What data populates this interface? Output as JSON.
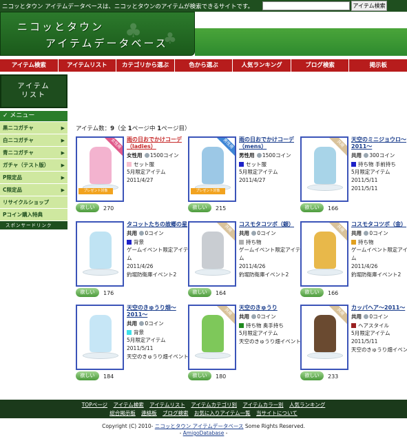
{
  "topbar": {
    "message": "ニコッとタウン アイテムデータベースは、ニコッとタウンのアイテムが検索できるサイトです。",
    "search_placeholder": "",
    "search_button": "アイテム検索"
  },
  "logo": {
    "line1": "ニコッとタウン",
    "line2": "アイテムデータベース"
  },
  "nav": [
    "アイテム検索",
    "アイテムリスト",
    "カテゴリから選ぶ",
    "色から選ぶ",
    "人気ランキング",
    "ブログ検索",
    "掲示板"
  ],
  "sidebar": {
    "title_line1": "アイテム",
    "title_line2": "リスト",
    "menu_head": "メニュー",
    "items": [
      "黒ニコガチャ",
      "白ニコガチャ",
      "青ニコガチャ",
      "ガチャ（テスト版）",
      "P限定品",
      "C限定品",
      "リサイクルショップ",
      "Pコイン購入特典"
    ],
    "sponsor": "スポンサードリンク"
  },
  "count": {
    "label": "アイテム数：",
    "num": "9",
    "mid": "（全 ",
    "pages": "1",
    "mid2": "ページ中 ",
    "page": "1",
    "tail": "ページ目）"
  },
  "want_label": "欲しい",
  "coin_unit": "コイン",
  "items": [
    {
      "name": "雨の日おでかけコーデ（ladies）",
      "name_color": "red",
      "gender": "女性用",
      "coin": "1500",
      "category": "セット服",
      "cat_color": "#f6c0cf",
      "note1": "5月限定アイテム",
      "note2": "2011/4/27",
      "count": "270",
      "badge": "女性用",
      "badge_color": "#e05a8a",
      "fig_color": "#f3b3cf",
      "present": "プレゼント対象"
    },
    {
      "name": "雨の日おでかけコーデ（mens）",
      "name_color": "blue",
      "gender": "男性用",
      "coin": "1500",
      "category": "セット服",
      "cat_color": "#1e22c8",
      "note1": "5月限定アイテム",
      "note2": "2011/4/27",
      "count": "215",
      "badge": "男性用",
      "badge_color": "#3f86d6",
      "fig_color": "#9cc8e6",
      "present": "プレゼント対象"
    },
    {
      "name": "天空のミニジョウロ～2011～",
      "name_color": "blue",
      "gender": "共用",
      "coin": "300",
      "category": "持ち物 手前持ち",
      "cat_color": "#1e22c8",
      "note1": "5月限定アイテム",
      "note2": "2011/5/11",
      "count": "166",
      "badge": "共用",
      "badge_color": "#d9c29a",
      "fig_color": "#a8d4e8",
      "present": ""
    },
    {
      "name": "タコットたちの故郷の星",
      "name_color": "blue",
      "gender": "共用",
      "coin": "0",
      "category": "背景",
      "cat_color": "#1e22c8",
      "note1": "ゲームイベント限定アイテム",
      "note2": "2011/4/26",
      "count": "176",
      "badge": "",
      "badge_color": "",
      "fig_color": "#bfe3f3",
      "present": ""
    },
    {
      "name": "コスモタコツボ（銀）",
      "name_color": "blue",
      "gender": "共用",
      "coin": "0",
      "category": "持ち物",
      "cat_color": "#b0b0b0",
      "note1": "ゲームイベント限定アイテム",
      "note2": "2011/4/26",
      "count": "164",
      "badge": "共用",
      "badge_color": "#d9c29a",
      "fig_color": "#c9cdd2",
      "present": ""
    },
    {
      "name": "コスモタコツボ（金）",
      "name_color": "blue",
      "gender": "共用",
      "coin": "0",
      "category": "持ち物",
      "cat_color": "#e0a020",
      "note1": "ゲームイベント限定アイテム",
      "note2": "2011/4/26",
      "count": "166",
      "badge": "共用",
      "badge_color": "#d9c29a",
      "fig_color": "#e8b84a",
      "present": ""
    },
    {
      "name": "天空のきゅうり畑～2011～",
      "name_color": "blue",
      "gender": "共用",
      "coin": "0",
      "category": "背景",
      "cat_color": "#3ee0e8",
      "note1": "5月限定アイテム",
      "note2": "2011/5/11",
      "count": "184",
      "badge": "",
      "badge_color": "",
      "fig_color": "#c6e6f6",
      "present": ""
    },
    {
      "name": "天空のきゅうり",
      "name_color": "blue",
      "gender": "共用",
      "coin": "0",
      "category": "持ち物 奥手持ち",
      "cat_color": "#1f8a1f",
      "note1": "5月限定アイテム",
      "note2": "天空のきゅうり畑イベント",
      "count": "180",
      "badge": "共用",
      "badge_color": "#d9c29a",
      "fig_color": "#7ec85a",
      "present": ""
    },
    {
      "name": "カッパヘア～2011～",
      "name_color": "blue",
      "gender": "共用",
      "coin": "0",
      "category": "ヘアスタイル",
      "cat_color": "#9a2020",
      "note1": "5月限定アイテム",
      "note2": "2011/5/11",
      "note3": "天空のきゅうり畑イベント",
      "count": "233",
      "badge": "共用",
      "badge_color": "#d9c29a",
      "fig_color": "#6a4a30",
      "present": ""
    }
  ],
  "extra_notes": {
    "item2_note3": "2011/5/11",
    "item3_note3": "釣堀防衛庫イベント2",
    "item4_note3": "釣堀防衛庫イベント2",
    "item5_note3": "釣堀防衛庫イベント2",
    "item6_note3": "天空のきゅうり畑イベント",
    "item7_date": "2011/5/11"
  },
  "footer": {
    "row1": [
      "TOPページ",
      "アイテム検索",
      "アイテムリスト",
      "アイテムカテゴリ別",
      "アイテムカラー別",
      "人気ランキング"
    ],
    "row2": [
      "総合掲示板",
      "連絡板",
      "ブログ検索",
      "お気に入りアイテム一覧",
      "当サイトについて"
    ]
  },
  "copyright": {
    "text": "Copyright (C) 2010- ",
    "site": "ニコッとタウン アイテムデータベース",
    "rights": " Some Rights Reserved.",
    "line2_pre": "- ",
    "company": "AmigoDatabase",
    "line2_post": " -"
  }
}
